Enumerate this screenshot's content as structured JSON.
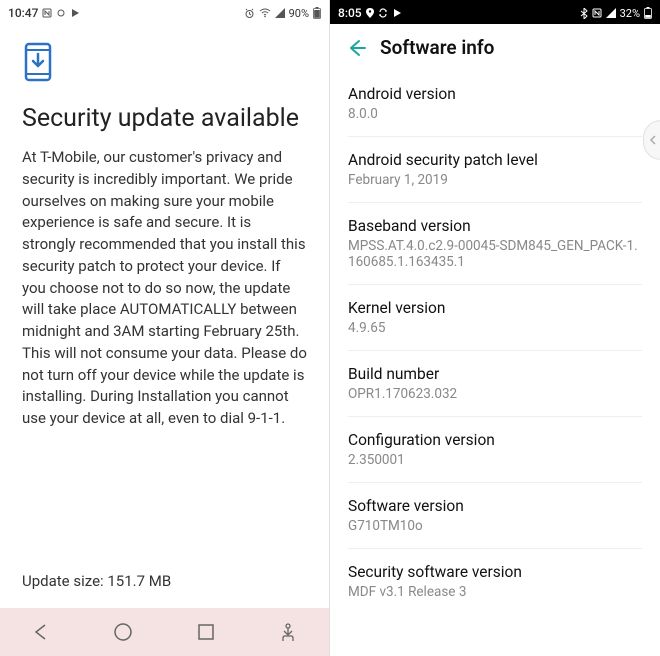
{
  "left": {
    "status": {
      "time": "10:47",
      "battery": "90%"
    },
    "title": "Security update available",
    "body": "At T-Mobile, our customer's privacy and security is incredibly important. We pride ourselves on making sure your mobile experience is safe and secure. It is strongly recommended that you install this security patch to protect your device. If you choose not to do so now, the update will take place AUTOMATICALLY between midnight and 3AM starting February 25th. This will not consume your data. Please do not turn off your device while the update is installing. During Installation you cannot use your device at all, even to dial 9-1-1.",
    "update_size": "Update size: 151.7 MB"
  },
  "right": {
    "status": {
      "time": "8:05",
      "battery": "32%"
    },
    "header": "Software info",
    "rows": [
      {
        "label": "Android version",
        "value": "8.0.0"
      },
      {
        "label": "Android security patch level",
        "value": "February 1, 2019"
      },
      {
        "label": "Baseband version",
        "value": "MPSS.AT.4.0.c2.9-00045-SDM845_GEN_PACK-1.160685.1.163435.1"
      },
      {
        "label": "Kernel version",
        "value": "4.9.65"
      },
      {
        "label": "Build number",
        "value": "OPR1.170623.032"
      },
      {
        "label": "Configuration version",
        "value": "2.350001"
      },
      {
        "label": "Software version",
        "value": "G710TM10o"
      },
      {
        "label": "Security software version",
        "value": "MDF v3.1 Release 3"
      }
    ]
  }
}
